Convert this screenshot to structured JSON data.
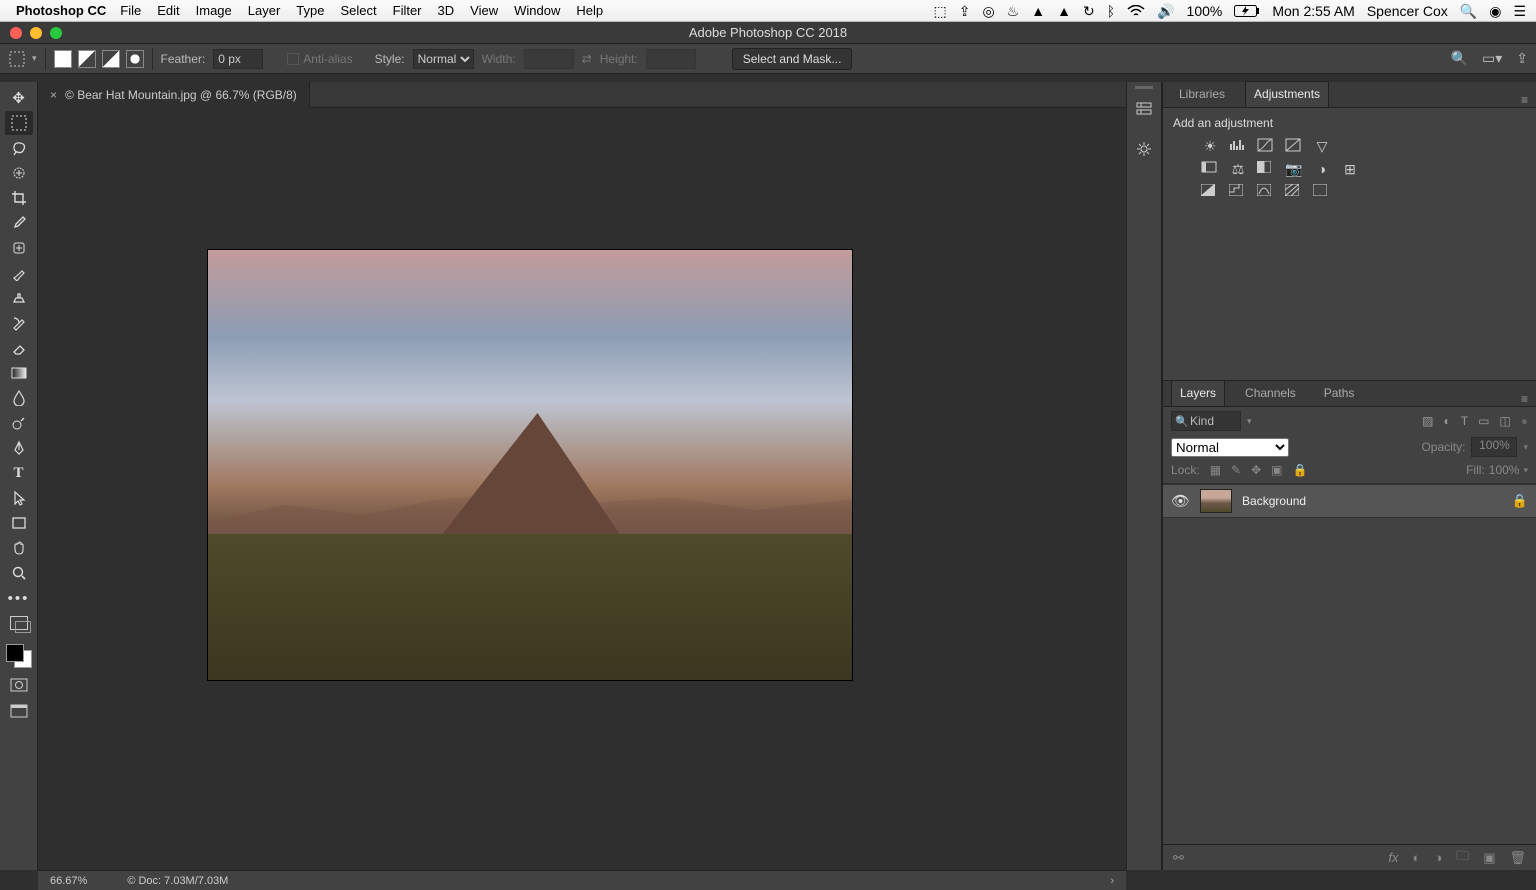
{
  "mac": {
    "app_title": "Photoshop CC",
    "menus": [
      "File",
      "Edit",
      "Image",
      "Layer",
      "Type",
      "Select",
      "Filter",
      "3D",
      "View",
      "Window",
      "Help"
    ],
    "battery": "100%",
    "clock": "Mon 2:55 AM",
    "user": "Spencer Cox"
  },
  "window": {
    "title": "Adobe Photoshop CC 2018"
  },
  "options": {
    "feather_label": "Feather:",
    "feather_value": "0 px",
    "antialias_label": "Anti-alias",
    "style_label": "Style:",
    "style_value": "Normal",
    "width_label": "Width:",
    "height_label": "Height:",
    "select_mask": "Select and Mask..."
  },
  "document": {
    "tab_label": "© Bear Hat Mountain.jpg @ 66.7% (RGB/8)"
  },
  "adjustments": {
    "tab_libraries": "Libraries",
    "tab_adjustments": "Adjustments",
    "heading": "Add an adjustment"
  },
  "layers": {
    "tab_layers": "Layers",
    "tab_channels": "Channels",
    "tab_paths": "Paths",
    "kind_label": "Kind",
    "blend_value": "Normal",
    "opacity_label": "Opacity:",
    "opacity_value": "100%",
    "lock_label": "Lock:",
    "fill_label": "Fill:",
    "fill_value": "100%",
    "item_name": "Background"
  },
  "status": {
    "zoom": "66.67%",
    "doc": "© Doc: 7.03M/7.03M"
  }
}
